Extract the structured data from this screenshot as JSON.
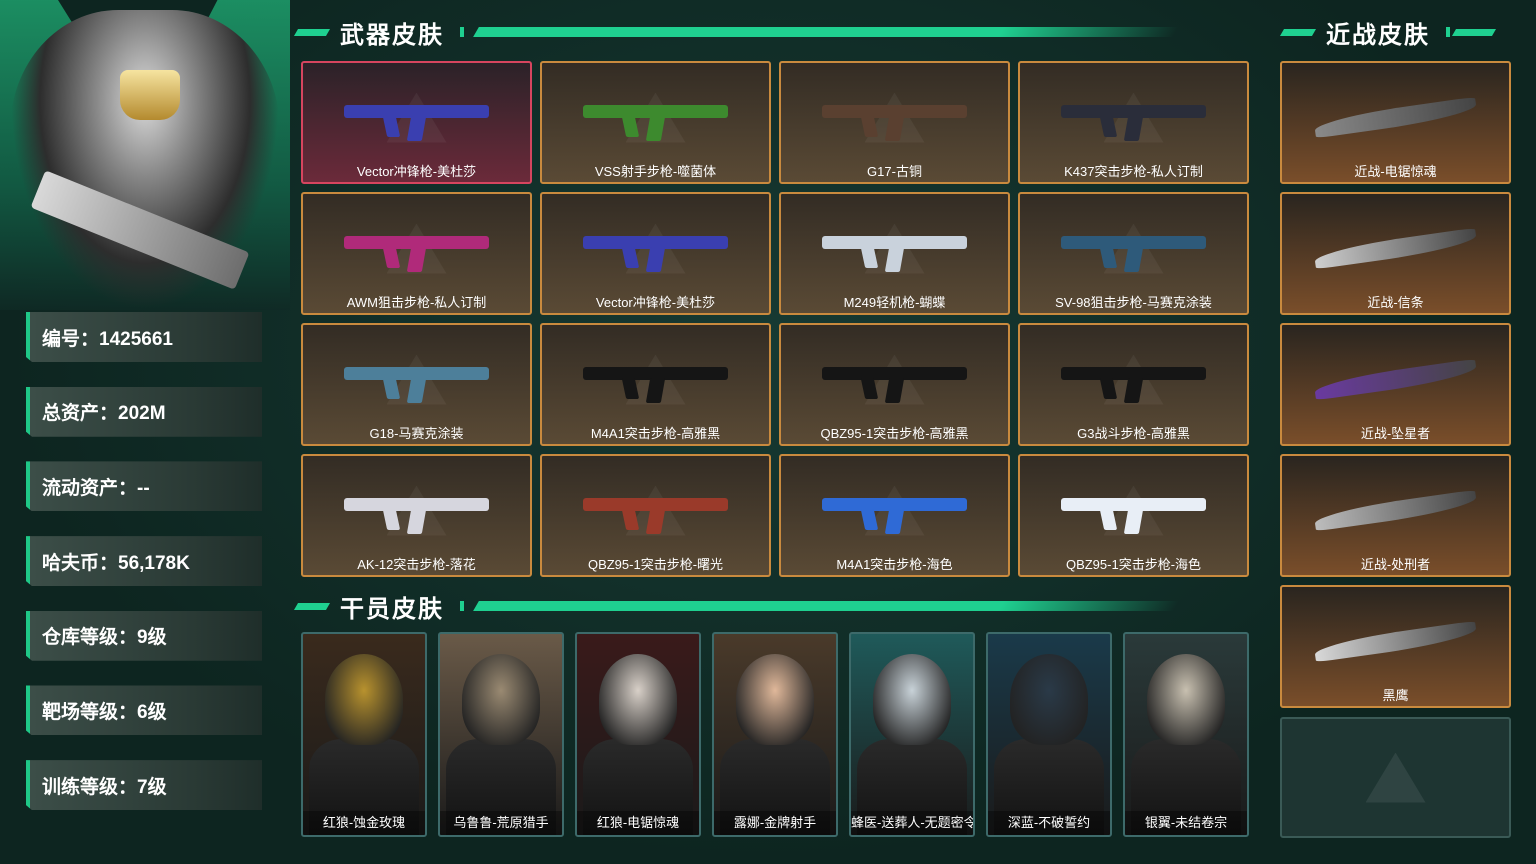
{
  "profile": {
    "stats": [
      {
        "label": "编号：1425661"
      },
      {
        "label": "总资产：202M"
      },
      {
        "label": "流动资产：--"
      },
      {
        "label": "哈夫币：56,178K"
      },
      {
        "label": "仓库等级：9级"
      },
      {
        "label": "靶场等级：6级"
      },
      {
        "label": "训练等级：7级"
      }
    ]
  },
  "sections": {
    "weapon_title": "武器皮肤",
    "melee_title": "近战皮肤",
    "operator_title": "干员皮肤"
  },
  "weapons": [
    {
      "name": "Vector冲锋枪-美杜莎",
      "rarity": "red",
      "color": "#3a3fb0"
    },
    {
      "name": "VSS射手步枪-噬菌体",
      "rarity": "gold",
      "color": "#3d8a2e"
    },
    {
      "name": "G17-古铜",
      "rarity": "gold",
      "color": "#5a4030"
    },
    {
      "name": "K437突击步枪-私人订制",
      "rarity": "gold",
      "color": "#2a2d3a"
    },
    {
      "name": "AWM狙击步枪-私人订制",
      "rarity": "gold",
      "color": "#b02a7a"
    },
    {
      "name": "Vector冲锋枪-美杜莎",
      "rarity": "gold",
      "color": "#3a3fb0"
    },
    {
      "name": "M249轻机枪-蝴蝶",
      "rarity": "gold",
      "color": "#c9d2dc"
    },
    {
      "name": "SV-98狙击步枪-马赛克涂装",
      "rarity": "gold",
      "color": "#2e5a7a"
    },
    {
      "name": "G18-马赛克涂装",
      "rarity": "gold",
      "color": "#4d7f9a"
    },
    {
      "name": "M4A1突击步枪-高雅黑",
      "rarity": "gold",
      "color": "#151515"
    },
    {
      "name": "QBZ95-1突击步枪-高雅黑",
      "rarity": "gold",
      "color": "#151515"
    },
    {
      "name": "G3战斗步枪-高雅黑",
      "rarity": "gold",
      "color": "#151515"
    },
    {
      "name": "AK-12突击步枪-落花",
      "rarity": "gold",
      "color": "#d6d6de"
    },
    {
      "name": "QBZ95-1突击步枪-曙光",
      "rarity": "gold",
      "color": "#9a3a2a"
    },
    {
      "name": "M4A1突击步枪-海色",
      "rarity": "gold",
      "color": "#2f6ad6"
    },
    {
      "name": "QBZ95-1突击步枪-海色",
      "rarity": "gold",
      "color": "#e8eef6"
    }
  ],
  "melee": [
    {
      "name": "近战-电锯惊魂",
      "color": "#8a8a8a"
    },
    {
      "name": "近战-信条",
      "color": "#cfcfcf"
    },
    {
      "name": "近战-坠星者",
      "color": "#6a3aa0"
    },
    {
      "name": "近战-处刑者",
      "color": "#bdbdbd"
    },
    {
      "name": "黑鹰",
      "color": "#d9d9d9"
    }
  ],
  "operators": [
    {
      "name": "红狼-蚀金玫瑰",
      "bg": "#3a2a1c",
      "accent": "#b8922e"
    },
    {
      "name": "乌鲁鲁-荒原猎手",
      "bg": "#6a5a48",
      "accent": "#9a8a72"
    },
    {
      "name": "红狼-电锯惊魂",
      "bg": "#3a1a1a",
      "accent": "#d8d0c8"
    },
    {
      "name": "露娜-金牌射手",
      "bg": "#4a3a2a",
      "accent": "#e0b89a"
    },
    {
      "name": "蜂医-送葬人-无题密令",
      "bg": "#1f5a5a",
      "accent": "#c8d2d8"
    },
    {
      "name": "深蓝-不破誓约",
      "bg": "#1a3a4a",
      "accent": "#2a3a48"
    },
    {
      "name": "银翼-未结卷宗",
      "bg": "#2a3a3a",
      "accent": "#c8c0b0"
    }
  ]
}
